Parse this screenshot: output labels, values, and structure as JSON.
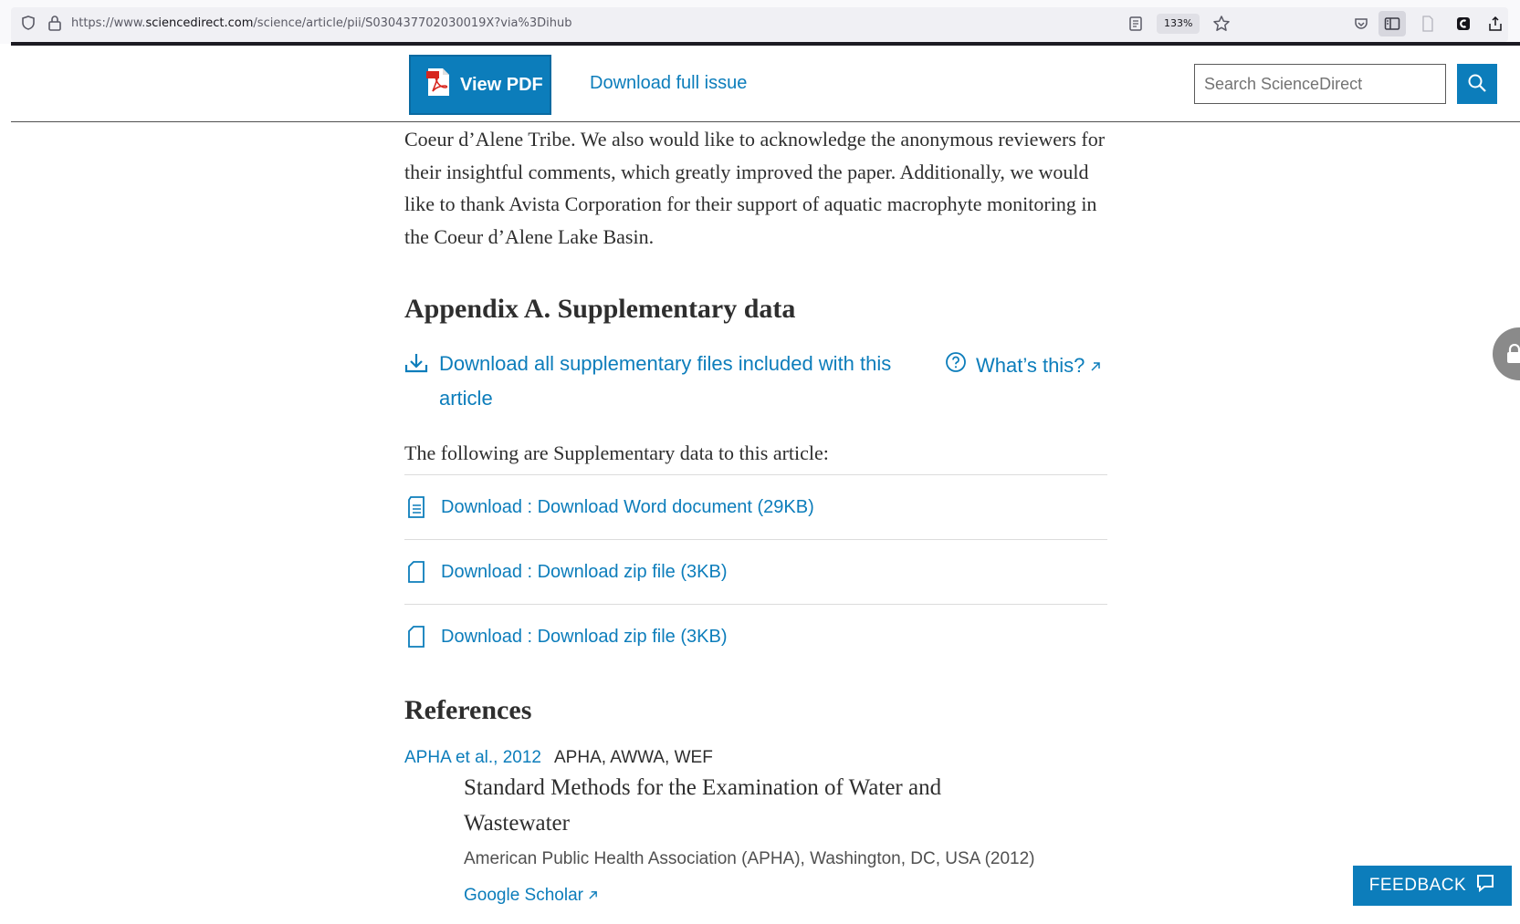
{
  "browser": {
    "url_prefix": "https://www.",
    "url_host": "sciencedirect.com",
    "url_path": "/science/article/pii/S030437702030019X?via%3Dihub",
    "zoom": "133%"
  },
  "header": {
    "view_pdf_label": "View PDF",
    "download_issue_label": "Download full issue",
    "search_placeholder": "Search ScienceDirect"
  },
  "acknowledgment": {
    "text": "Coeur d’Alene Tribe. We also would like to acknowledge the anonymous reviewers for their insightful comments, which greatly improved the paper. Additionally, we would like to thank Avista Corporation for their support of aquatic macrophyte monitoring in the Coeur d’Alene Lake Basin."
  },
  "appendix": {
    "title": "Appendix A. Supplementary data",
    "download_all_label": "Download all supplementary files included with this article",
    "whats_this_label": "What’s this?",
    "following_text": "The following are Supplementary data to this article:",
    "files": [
      {
        "label": "Download : Download Word document (29KB)",
        "icon": "document-icon"
      },
      {
        "label": "Download : Download zip file (3KB)",
        "icon": "file-icon"
      },
      {
        "label": "Download : Download zip file (3KB)",
        "icon": "file-icon"
      }
    ]
  },
  "references": {
    "title": "References",
    "items": [
      {
        "link": "APHA et al., 2012",
        "authors": "APHA, AWWA, WEF",
        "title": "Standard Methods for the Examination of Water and Wastewater",
        "publisher": "American Public Health Association (APHA), Washington, DC, USA (2012)",
        "scholar_label": "Google Scholar"
      }
    ]
  },
  "feedback_label": "FEEDBACK",
  "colors": {
    "accent": "#0c7dbb",
    "text": "#2e2e2e"
  }
}
